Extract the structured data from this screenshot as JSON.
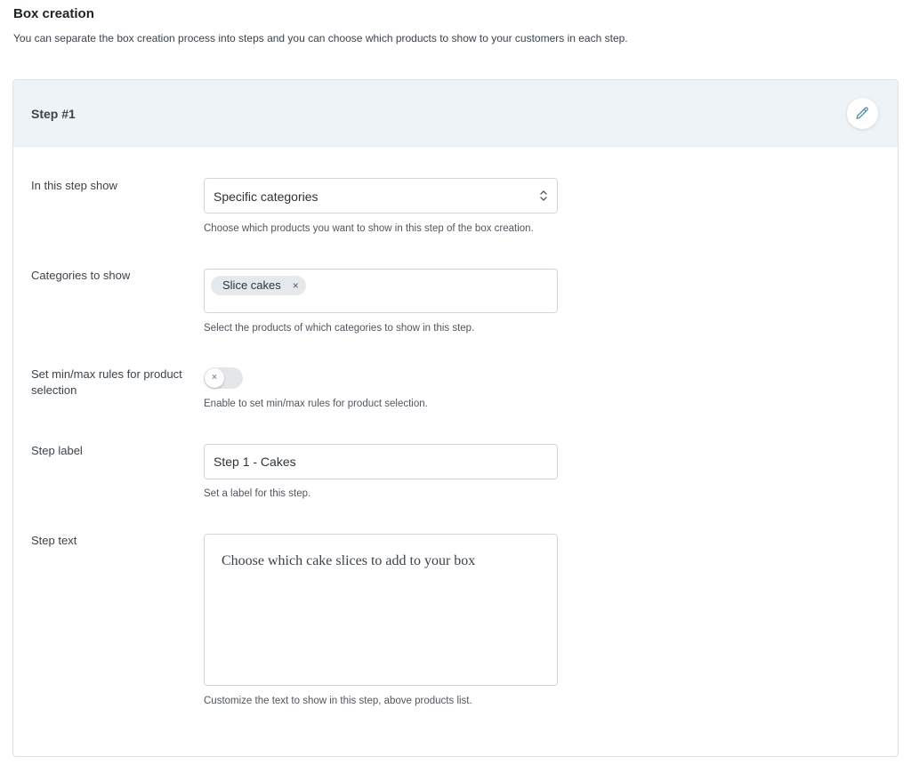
{
  "section": {
    "title": "Box creation",
    "description": "You can separate the box creation process into steps and you can choose which products to show to your customers in each step."
  },
  "step": {
    "title": "Step #1",
    "edit_icon": "pencil-icon",
    "show_field": {
      "label": "In this step show",
      "value": "Specific categories",
      "help": "Choose which products you want to show in this step of the box creation."
    },
    "categories_field": {
      "label": "Categories to show",
      "tags": [
        "Slice cakes"
      ],
      "tag_remove": "×",
      "help": "Select the products of which categories to show in this step."
    },
    "minmax_field": {
      "label": "Set min/max rules for product selection",
      "enabled": false,
      "knob_symbol": "×",
      "help": "Enable to set min/max rules for product selection."
    },
    "label_field": {
      "label": "Step label",
      "value": "Step 1 - Cakes",
      "help": "Set a label for this step."
    },
    "text_field": {
      "label": "Step text",
      "value": "Choose which cake slices to add to your box",
      "help": "Customize the text to show in this step, above products list."
    }
  },
  "colors": {
    "header_bg": "#edf3f7",
    "accent_icon": "#4c8ba8",
    "border": "#d0d7dc"
  }
}
